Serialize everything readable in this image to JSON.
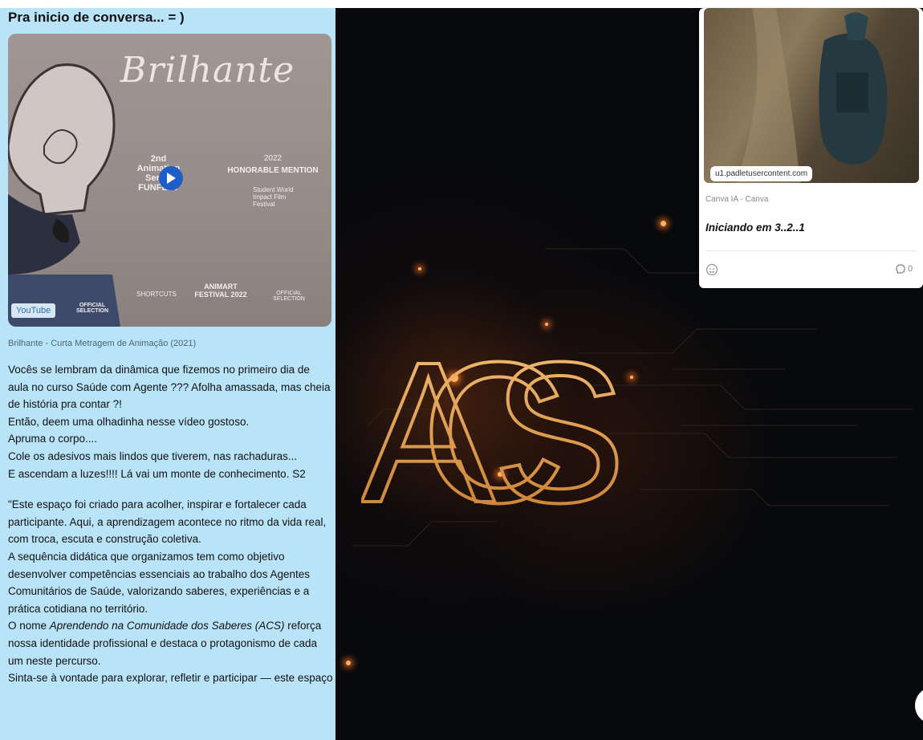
{
  "left_card": {
    "heading": "Pra inicio de conversa... = )",
    "video": {
      "thumbnail_title": "Brilhante",
      "laurel_left": "2nd Animation Series FUNFEST",
      "laurel_right_year": "2022",
      "laurel_right_label": "HONORABLE MENTION",
      "laurel_right_org": "Student World Impact Film Festival",
      "bottom_laurels": [
        "OFFICIAL SELECTION",
        "SHORTCUTS",
        "ANIMART FESTIVAL 2022",
        "OFFICIAL SELECTION"
      ],
      "source_badge": "YouTube",
      "caption": "Brilhante - Curta Metragem de Animação (2021)"
    },
    "paragraphs": [
      "Vocês se lembram da dinâmica que fizemos no primeiro dia de aula no curso Saúde com Agente ??? Afolha amassada, mas cheia de história pra contar ?!",
      "Então, deem uma olhadinha nesse vídeo gostoso.",
      "Apruma o corpo....",
      "Cole os adesivos mais lindos que tiverem, nas rachaduras...",
      "E ascendam a luzes!!!! Lá vai um monte de conhecimento. S2"
    ],
    "paragraphs_2": [
      "\"Este espaço foi criado para acolher, inspirar e fortalecer cada participante. Aqui, a aprendizagem acontece no ritmo da vida real, com troca, escuta e construção coletiva.",
      "A sequência didática que organizamos tem como objetivo desenvolver competências essenciais ao trabalho dos Agentes Comunitários de Saúde, valorizando saberes, experiências e a prática cotidiana no território."
    ],
    "name_prefix": "O nome ",
    "name_italic": "Aprendendo na Comunidade dos Saberes (ACS)",
    "name_suffix": " reforça nossa identidade profissional e destaca o protagonismo de cada um neste percurso.",
    "last_line": "Sinta-se à vontade para explorar, refletir e participar — este espaço"
  },
  "background": {
    "title": "ACS"
  },
  "right_card": {
    "url": "u1.padletusercontent.com",
    "source": "Canva IA - Canva",
    "title": "Iniciando em 3..2..1",
    "comment_count": "0"
  },
  "colors": {
    "left_card_bg": "#b9e3f7",
    "accent_play": "#1e5ec8",
    "acs_gold": "#e8a54a"
  }
}
